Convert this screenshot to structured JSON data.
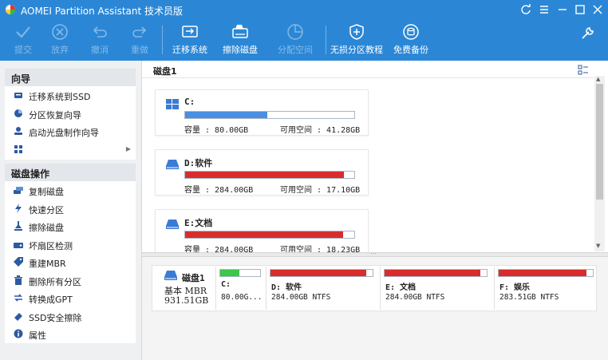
{
  "app": {
    "title": "AOMEI Partition Assistant 技术员版",
    "colors": {
      "brand": "#2b87d6",
      "partition_red": "#d92d2d",
      "partition_blue": "#4a8fe0",
      "partition_green": "#3cc64a"
    }
  },
  "toolbar": {
    "submit": "提交",
    "discard": "放弃",
    "undo": "撤消",
    "redo": "重做",
    "migrate": "迁移系统",
    "wipe": "擦除磁盘",
    "allocate": "分配空间",
    "unlimited": "无损分区教程",
    "backup": "免费备份"
  },
  "sidebar": {
    "wizard_title": "向导",
    "wizard_items": [
      {
        "label": "迁移系统到SSD",
        "icon": "ssd-migrate-icon"
      },
      {
        "label": "分区恢复向导",
        "icon": "recover-icon"
      },
      {
        "label": "启动光盘制作向导",
        "icon": "bootdisk-icon"
      },
      {
        "label": "",
        "icon": "apps-grid-icon"
      }
    ],
    "diskops_title": "磁盘操作",
    "diskops_items": [
      {
        "label": "复制磁盘",
        "icon": "copy-disk-icon"
      },
      {
        "label": "快速分区",
        "icon": "lightning-icon"
      },
      {
        "label": "擦除磁盘",
        "icon": "wipe-icon"
      },
      {
        "label": "坏扇区检测",
        "icon": "bad-sector-icon"
      },
      {
        "label": "重建MBR",
        "icon": "tag-icon"
      },
      {
        "label": "删除所有分区",
        "icon": "trash-icon"
      },
      {
        "label": "转换成GPT",
        "icon": "convert-icon"
      },
      {
        "label": "SSD安全擦除",
        "icon": "eraser-icon"
      },
      {
        "label": "属性",
        "icon": "info-icon"
      }
    ]
  },
  "disklist": {
    "header": "磁盘1",
    "partitions": [
      {
        "name": "C:",
        "capacity": "容量 : 80.00GB",
        "free": "可用空间 : 41.28GB",
        "used_fraction": 0.485,
        "color": "#4a8fe0"
      },
      {
        "name": "D:软件",
        "capacity": "容量 : 284.00GB",
        "free": "可用空间 : 17.10GB",
        "used_fraction": 0.94,
        "color": "#d92d2d"
      },
      {
        "name": "E:文档",
        "capacity": "容量 : 284.00GB",
        "free": "可用空间 : 18.23GB",
        "used_fraction": 0.936,
        "color": "#d92d2d"
      }
    ]
  },
  "diskmap": {
    "disk_name": "磁盘1",
    "disk_type": "基本 MBR",
    "disk_size": "931.51GB",
    "blocks": [
      {
        "name": "C:",
        "info": "80.00G...",
        "used_fraction": 0.485,
        "color": "#3cc64a"
      },
      {
        "name": "D: 软件",
        "info": "284.00GB NTFS",
        "used_fraction": 0.94,
        "color": "#d92d2d"
      },
      {
        "name": "E: 文档",
        "info": "284.00GB NTFS",
        "used_fraction": 0.936,
        "color": "#d92d2d"
      },
      {
        "name": "F: 娱乐",
        "info": "283.51GB NTFS",
        "used_fraction": 0.93,
        "color": "#d92d2d"
      }
    ]
  }
}
